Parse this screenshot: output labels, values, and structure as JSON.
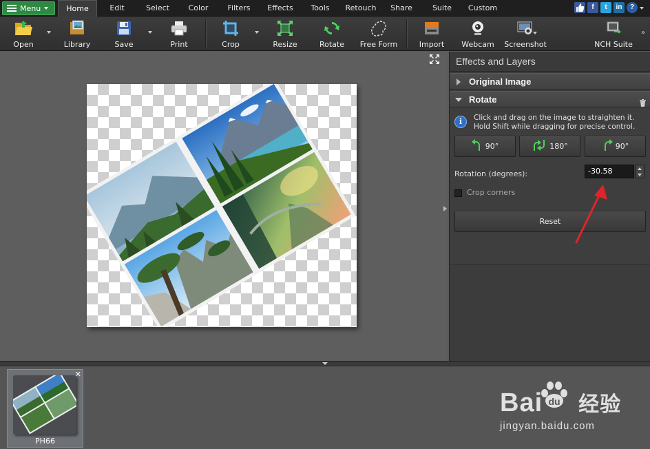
{
  "menubar": {
    "menu_label": "Menu",
    "tabs": [
      {
        "label": "Home",
        "active": true
      },
      {
        "label": "Edit"
      },
      {
        "label": "Select"
      },
      {
        "label": "Color"
      },
      {
        "label": "Filters"
      },
      {
        "label": "Effects"
      },
      {
        "label": "Tools"
      },
      {
        "label": "Retouch"
      },
      {
        "label": "Share"
      },
      {
        "label": "Suite"
      },
      {
        "label": "Custom"
      }
    ],
    "social_icons": [
      "thumbs-up-icon",
      "facebook-icon",
      "twitter-icon",
      "linkedin-icon",
      "help-icon"
    ]
  },
  "toolbar": {
    "items": [
      {
        "label": "Open",
        "icon": "folder-open-icon"
      },
      {
        "label": "Library",
        "icon": "library-icon"
      },
      {
        "label": "Save",
        "icon": "save-disk-icon"
      },
      {
        "label": "Print",
        "icon": "printer-icon"
      },
      {
        "label": "Crop",
        "icon": "crop-icon"
      },
      {
        "label": "Resize",
        "icon": "resize-icon"
      },
      {
        "label": "Rotate",
        "icon": "rotate-icon"
      },
      {
        "label": "Free Form",
        "icon": "free-form-icon"
      },
      {
        "label": "Import",
        "icon": "import-icon"
      },
      {
        "label": "Webcam",
        "icon": "webcam-icon"
      },
      {
        "label": "Screenshot",
        "icon": "screenshot-icon"
      },
      {
        "label": "NCH Suite",
        "icon": "nch-suite-icon"
      }
    ]
  },
  "panel": {
    "title": "Effects and Layers",
    "original_image_label": "Original Image",
    "rotate": {
      "header": "Rotate",
      "hint_line1": "Click and drag on the image to straighten it.",
      "hint_line2": "Hold Shift while dragging for precise control.",
      "buttons": [
        {
          "label": "90°",
          "icon": "rotate-left-icon"
        },
        {
          "label": "180°",
          "icon": "rotate-180-icon"
        },
        {
          "label": "90°",
          "icon": "rotate-right-icon"
        }
      ],
      "rotation_label": "Rotation (degrees):",
      "rotation_value": "-30.58",
      "crop_corners_label": "Crop corners",
      "crop_corners_checked": false,
      "reset_label": "Reset"
    }
  },
  "filmstrip": {
    "items": [
      {
        "name": "PH66"
      }
    ]
  },
  "watermark": {
    "brand": "Bai",
    "brand_cn": "经验",
    "url": "jingyan.baidu.com"
  },
  "colors": {
    "menu_green": "#2e8a42",
    "panel_bg": "#3c3c3c",
    "arrow_red": "#e0242b"
  }
}
